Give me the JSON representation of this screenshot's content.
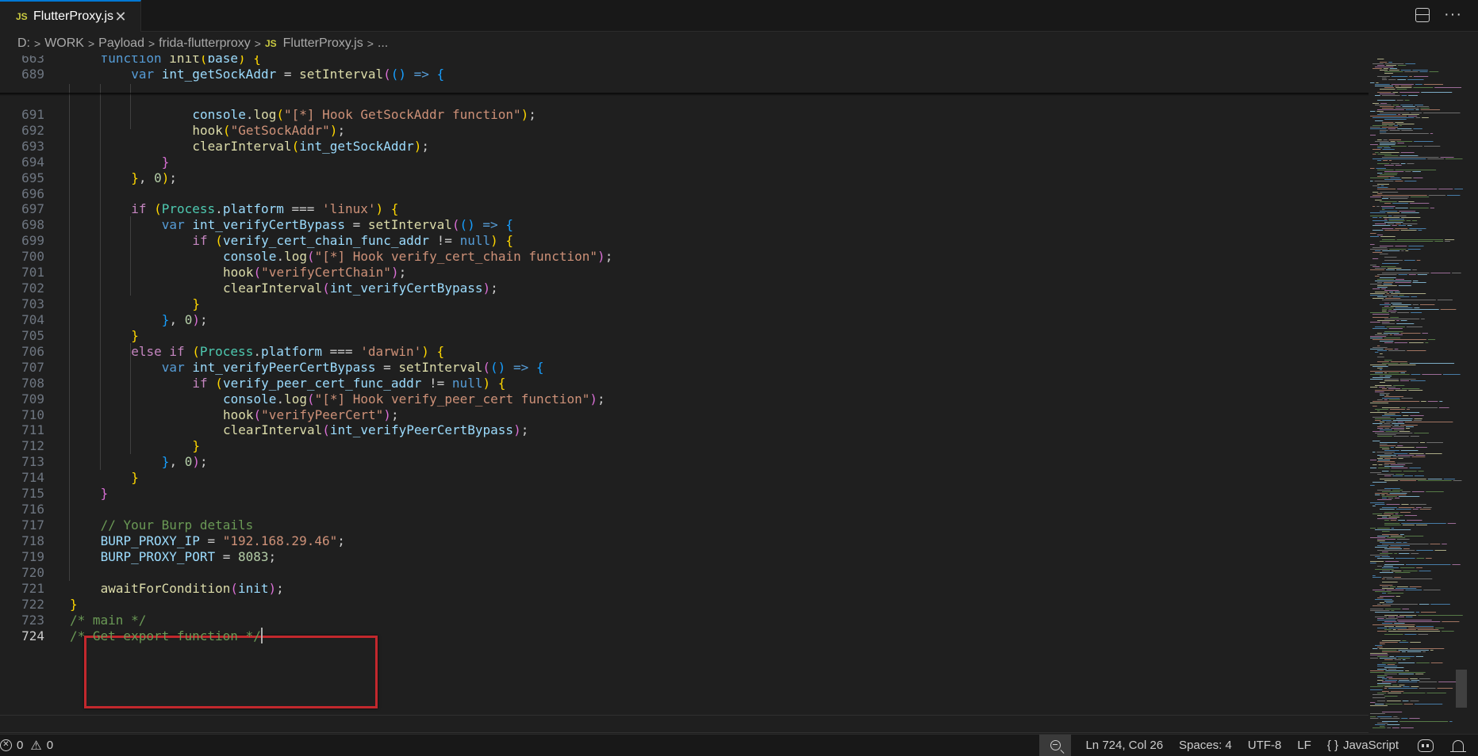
{
  "tab": {
    "file_icon": "JS",
    "label": "FlutterProxy.js",
    "close": "✕"
  },
  "tab_actions": {
    "layout_icon": "split-editor-icon",
    "more": "···"
  },
  "breadcrumb": {
    "parts": [
      "D:",
      "WORK",
      "Payload",
      "frida-flutterproxy"
    ],
    "file_icon": "JS",
    "file": "FlutterProxy.js",
    "trailing": "..."
  },
  "editor": {
    "lines": [
      {
        "n": "663",
        "sticky": true,
        "indent": 1,
        "tokens": [
          [
            "k",
            "function "
          ],
          [
            "f",
            "init"
          ],
          [
            "b1",
            "("
          ],
          [
            "v",
            "base"
          ],
          [
            "b1",
            ")"
          ],
          [
            "p",
            " "
          ],
          [
            "b1",
            "{"
          ]
        ]
      },
      {
        "n": "689",
        "sticky": true,
        "indent": 2,
        "tokens": [
          [
            "k",
            "var "
          ],
          [
            "v",
            "int_getSockAddr"
          ],
          [
            "p",
            " = "
          ],
          [
            "f",
            "setInterval"
          ],
          [
            "b2",
            "("
          ],
          [
            "b3",
            "()"
          ],
          [
            "p",
            " "
          ],
          [
            "k",
            "=>"
          ],
          [
            "p",
            " "
          ],
          [
            "b3",
            "{"
          ]
        ]
      },
      {
        "n": "691",
        "indent": 4,
        "tokens": [
          [
            "v",
            "console"
          ],
          [
            "p",
            "."
          ],
          [
            "f",
            "log"
          ],
          [
            "b1",
            "("
          ],
          [
            "s",
            "\"[*] Hook GetSockAddr function\""
          ],
          [
            "b1",
            ")"
          ],
          [
            "p",
            ";"
          ]
        ]
      },
      {
        "n": "692",
        "indent": 4,
        "tokens": [
          [
            "f",
            "hook"
          ],
          [
            "b1",
            "("
          ],
          [
            "s",
            "\"GetSockAddr\""
          ],
          [
            "b1",
            ")"
          ],
          [
            "p",
            ";"
          ]
        ]
      },
      {
        "n": "693",
        "indent": 4,
        "tokens": [
          [
            "f",
            "clearInterval"
          ],
          [
            "b1",
            "("
          ],
          [
            "v",
            "int_getSockAddr"
          ],
          [
            "b1",
            ")"
          ],
          [
            "p",
            ";"
          ]
        ]
      },
      {
        "n": "694",
        "indent": 3,
        "tokens": [
          [
            "b2",
            "}"
          ]
        ]
      },
      {
        "n": "695",
        "indent": 2,
        "tokens": [
          [
            "b1",
            "}"
          ],
          [
            "p",
            ", "
          ],
          [
            "n",
            "0"
          ],
          [
            "b1",
            ")"
          ],
          [
            "p",
            ";"
          ]
        ]
      },
      {
        "n": "696",
        "indent": 0,
        "tokens": []
      },
      {
        "n": "697",
        "indent": 2,
        "tokens": [
          [
            "kc",
            "if "
          ],
          [
            "b1",
            "("
          ],
          [
            "cl",
            "Process"
          ],
          [
            "p",
            "."
          ],
          [
            "v",
            "platform"
          ],
          [
            "p",
            " === "
          ],
          [
            "s",
            "'linux'"
          ],
          [
            "b1",
            ")"
          ],
          [
            "p",
            " "
          ],
          [
            "b1",
            "{"
          ]
        ]
      },
      {
        "n": "698",
        "indent": 3,
        "tokens": [
          [
            "k",
            "var "
          ],
          [
            "v",
            "int_verifyCertBypass"
          ],
          [
            "p",
            " = "
          ],
          [
            "f",
            "setInterval"
          ],
          [
            "b2",
            "("
          ],
          [
            "b3",
            "()"
          ],
          [
            "p",
            " "
          ],
          [
            "k",
            "=>"
          ],
          [
            "p",
            " "
          ],
          [
            "b3",
            "{"
          ]
        ]
      },
      {
        "n": "699",
        "indent": 4,
        "tokens": [
          [
            "kc",
            "if "
          ],
          [
            "b1",
            "("
          ],
          [
            "v",
            "verify_cert_chain_func_addr"
          ],
          [
            "p",
            " != "
          ],
          [
            "k",
            "null"
          ],
          [
            "b1",
            ")"
          ],
          [
            "p",
            " "
          ],
          [
            "b1",
            "{"
          ]
        ]
      },
      {
        "n": "700",
        "indent": 5,
        "tokens": [
          [
            "v",
            "console"
          ],
          [
            "p",
            "."
          ],
          [
            "f",
            "log"
          ],
          [
            "b2",
            "("
          ],
          [
            "s",
            "\"[*] Hook verify_cert_chain function\""
          ],
          [
            "b2",
            ")"
          ],
          [
            "p",
            ";"
          ]
        ]
      },
      {
        "n": "701",
        "indent": 5,
        "tokens": [
          [
            "f",
            "hook"
          ],
          [
            "b2",
            "("
          ],
          [
            "s",
            "\"verifyCertChain\""
          ],
          [
            "b2",
            ")"
          ],
          [
            "p",
            ";"
          ]
        ]
      },
      {
        "n": "702",
        "indent": 5,
        "tokens": [
          [
            "f",
            "clearInterval"
          ],
          [
            "b2",
            "("
          ],
          [
            "v",
            "int_verifyCertBypass"
          ],
          [
            "b2",
            ")"
          ],
          [
            "p",
            ";"
          ]
        ]
      },
      {
        "n": "703",
        "indent": 4,
        "tokens": [
          [
            "b1",
            "}"
          ]
        ]
      },
      {
        "n": "704",
        "indent": 3,
        "tokens": [
          [
            "b3",
            "}"
          ],
          [
            "p",
            ", "
          ],
          [
            "n",
            "0"
          ],
          [
            "b2",
            ")"
          ],
          [
            "p",
            ";"
          ]
        ]
      },
      {
        "n": "705",
        "indent": 2,
        "tokens": [
          [
            "b1",
            "}"
          ]
        ]
      },
      {
        "n": "706",
        "indent": 2,
        "tokens": [
          [
            "kc",
            "else if "
          ],
          [
            "b1",
            "("
          ],
          [
            "cl",
            "Process"
          ],
          [
            "p",
            "."
          ],
          [
            "v",
            "platform"
          ],
          [
            "p",
            " === "
          ],
          [
            "s",
            "'darwin'"
          ],
          [
            "b1",
            ")"
          ],
          [
            "p",
            " "
          ],
          [
            "b1",
            "{"
          ]
        ]
      },
      {
        "n": "707",
        "indent": 3,
        "tokens": [
          [
            "k",
            "var "
          ],
          [
            "v",
            "int_verifyPeerCertBypass"
          ],
          [
            "p",
            " = "
          ],
          [
            "f",
            "setInterval"
          ],
          [
            "b2",
            "("
          ],
          [
            "b3",
            "()"
          ],
          [
            "p",
            " "
          ],
          [
            "k",
            "=>"
          ],
          [
            "p",
            " "
          ],
          [
            "b3",
            "{"
          ]
        ]
      },
      {
        "n": "708",
        "indent": 4,
        "tokens": [
          [
            "kc",
            "if "
          ],
          [
            "b1",
            "("
          ],
          [
            "v",
            "verify_peer_cert_func_addr"
          ],
          [
            "p",
            " != "
          ],
          [
            "k",
            "null"
          ],
          [
            "b1",
            ")"
          ],
          [
            "p",
            " "
          ],
          [
            "b1",
            "{"
          ]
        ]
      },
      {
        "n": "709",
        "indent": 5,
        "tokens": [
          [
            "v",
            "console"
          ],
          [
            "p",
            "."
          ],
          [
            "f",
            "log"
          ],
          [
            "b2",
            "("
          ],
          [
            "s",
            "\"[*] Hook verify_peer_cert function\""
          ],
          [
            "b2",
            ")"
          ],
          [
            "p",
            ";"
          ]
        ]
      },
      {
        "n": "710",
        "indent": 5,
        "tokens": [
          [
            "f",
            "hook"
          ],
          [
            "b2",
            "("
          ],
          [
            "s",
            "\"verifyPeerCert\""
          ],
          [
            "b2",
            ")"
          ],
          [
            "p",
            ";"
          ]
        ]
      },
      {
        "n": "711",
        "indent": 5,
        "tokens": [
          [
            "f",
            "clearInterval"
          ],
          [
            "b2",
            "("
          ],
          [
            "v",
            "int_verifyPeerCertBypass"
          ],
          [
            "b2",
            ")"
          ],
          [
            "p",
            ";"
          ]
        ]
      },
      {
        "n": "712",
        "indent": 4,
        "tokens": [
          [
            "b1",
            "}"
          ]
        ]
      },
      {
        "n": "713",
        "indent": 3,
        "tokens": [
          [
            "b3",
            "}"
          ],
          [
            "p",
            ", "
          ],
          [
            "n",
            "0"
          ],
          [
            "b2",
            ")"
          ],
          [
            "p",
            ";"
          ]
        ]
      },
      {
        "n": "714",
        "indent": 2,
        "tokens": [
          [
            "b1",
            "}"
          ]
        ]
      },
      {
        "n": "715",
        "indent": 1,
        "tokens": [
          [
            "b2",
            "}"
          ]
        ]
      },
      {
        "n": "716",
        "indent": 0,
        "tokens": []
      },
      {
        "n": "717",
        "indent": 1,
        "tokens": [
          [
            "c",
            "// Your Burp details"
          ]
        ]
      },
      {
        "n": "718",
        "indent": 1,
        "tokens": [
          [
            "v",
            "BURP_PROXY_IP"
          ],
          [
            "p",
            " = "
          ],
          [
            "s",
            "\"192.168.29.46\""
          ],
          [
            "p",
            ";"
          ]
        ]
      },
      {
        "n": "719",
        "indent": 1,
        "tokens": [
          [
            "v",
            "BURP_PROXY_PORT"
          ],
          [
            "p",
            " = "
          ],
          [
            "n",
            "8083"
          ],
          [
            "p",
            ";"
          ]
        ]
      },
      {
        "n": "720",
        "indent": 0,
        "tokens": []
      },
      {
        "n": "721",
        "indent": 1,
        "tokens": [
          [
            "f",
            "awaitForCondition"
          ],
          [
            "b2",
            "("
          ],
          [
            "v",
            "init"
          ],
          [
            "b2",
            ")"
          ],
          [
            "p",
            ";"
          ]
        ]
      },
      {
        "n": "722",
        "indent": 0,
        "tokens": [
          [
            "b1",
            "}"
          ]
        ]
      },
      {
        "n": "723",
        "indent": 0,
        "tokens": [
          [
            "c",
            "/* main */"
          ]
        ]
      },
      {
        "n": "724",
        "indent": 0,
        "active": true,
        "tokens": [
          [
            "c",
            "/* Get export function */"
          ]
        ]
      }
    ]
  },
  "statusbar": {
    "errors": "0",
    "warnings": "0",
    "position": "Ln 724, Col 26",
    "spaces": "Spaces: 4",
    "encoding": "UTF-8",
    "eol": "LF",
    "language_braces": "{ }",
    "language": "JavaScript"
  },
  "colors": {
    "accent": "#0078d4",
    "highlight_box": "#c2282d"
  }
}
